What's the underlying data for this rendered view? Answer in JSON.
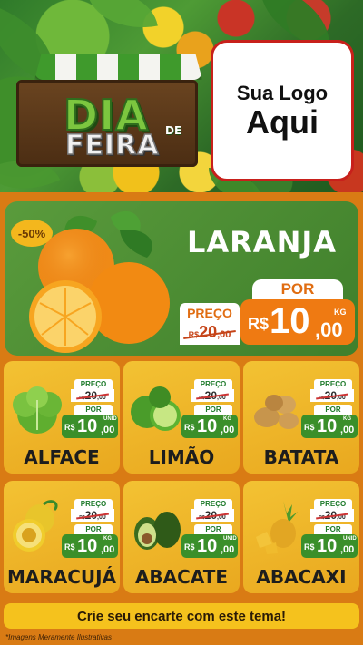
{
  "header": {
    "title_line1": "DIA",
    "title_de": "DE",
    "title_line2": "FEIRA",
    "logo_line1": "Sua Logo",
    "logo_line2": "Aqui"
  },
  "featured": {
    "badge": "-50%",
    "name": "LARANJA",
    "old_label": "PREÇO",
    "old_currency": "R$",
    "old_int": "20",
    "old_cents": ",00",
    "new_label": "POR",
    "new_currency": "R$",
    "new_int": "10",
    "new_cents": ",00",
    "unit": "KG"
  },
  "products": [
    {
      "name": "ALFACE",
      "old_label": "PREÇO",
      "old_currency": "R$",
      "old_int": "20",
      "old_cents": ",00",
      "new_label": "POR",
      "new_currency": "R$",
      "new_int": "10",
      "new_cents": ",00",
      "unit": "UNID"
    },
    {
      "name": "LIMÃO",
      "old_label": "PREÇO",
      "old_currency": "R$",
      "old_int": "20",
      "old_cents": ",00",
      "new_label": "POR",
      "new_currency": "R$",
      "new_int": "10",
      "new_cents": ",00",
      "unit": "KG"
    },
    {
      "name": "BATATA",
      "old_label": "PREÇO",
      "old_currency": "R$",
      "old_int": "20",
      "old_cents": ",00",
      "new_label": "POR",
      "new_currency": "R$",
      "new_int": "10",
      "new_cents": ",00",
      "unit": "KG"
    },
    {
      "name": "MARACUJÁ",
      "old_label": "PREÇO",
      "old_currency": "R$",
      "old_int": "20",
      "old_cents": ",00",
      "new_label": "POR",
      "new_currency": "R$",
      "new_int": "10",
      "new_cents": ",00",
      "unit": "KG"
    },
    {
      "name": "ABACATE",
      "old_label": "PREÇO",
      "old_currency": "R$",
      "old_int": "20",
      "old_cents": ",00",
      "new_label": "POR",
      "new_currency": "R$",
      "new_int": "10",
      "new_cents": ",00",
      "unit": "UNID"
    },
    {
      "name": "ABACAXI",
      "old_label": "PREÇO",
      "old_currency": "R$",
      "old_int": "20",
      "old_cents": ",00",
      "new_label": "POR",
      "new_currency": "R$",
      "new_int": "10",
      "new_cents": ",00",
      "unit": "UNID"
    }
  ],
  "footer": {
    "cta": "Crie seu encarte com este tema!",
    "disclaimer": "*Imagens Meramente Ilustrativas"
  },
  "colors": {
    "background": "#d97b14",
    "featured_green": "#4a8c33",
    "card_yellow": "#f0b62a",
    "price_green": "#3a8f2a",
    "price_orange": "#ef7a12",
    "logo_border": "#c8201b"
  }
}
